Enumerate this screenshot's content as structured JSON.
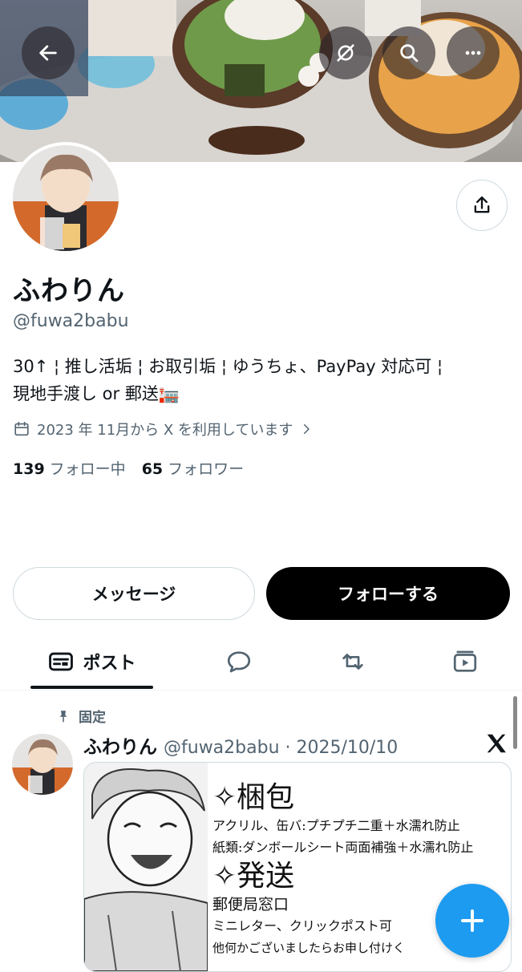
{
  "header": {
    "icons": [
      "back-arrow-icon",
      "grok-icon",
      "search-icon",
      "more-icon"
    ]
  },
  "profile": {
    "display_name": "ふわりん",
    "handle": "@fuwa2babu",
    "bio_line1": "30↑ ¦ 推し活垢 ¦ お取引垢 ¦ ゆうちょ、PayPay 対応可 ¦",
    "bio_line2": "現地手渡し or 郵送🏣",
    "joined": "2023 年 11月から X を利用しています",
    "following_count": "139",
    "following_label": "フォロー中",
    "followers_count": "65",
    "followers_label": "フォロワー"
  },
  "actions": {
    "message_label": "メッセージ",
    "follow_label": "フォローする"
  },
  "tabs": {
    "posts_label": "ポスト",
    "icons": [
      "posts-icon",
      "replies-icon",
      "reposts-icon",
      "media-icon"
    ]
  },
  "post": {
    "pinned_label": "固定",
    "author_name": "ふわりん",
    "author_meta": "@fuwa2babu · 2025/10/10",
    "card": {
      "heading1": "✧梱包",
      "line1": "アクリル、缶バ:プチプチ二重＋水濡れ防止",
      "line2": "紙類:ダンボールシート両面補強＋水濡れ防止",
      "heading2": "✧発送",
      "line3": "郵便局窓口",
      "line4": "ミニレター、クリックポスト可",
      "line5": "他何かございましたらお申し付けく"
    }
  },
  "colors": {
    "accent": "#1d9bf0",
    "text": "#0f1419",
    "muted": "#536471",
    "border": "#cfd9de"
  }
}
